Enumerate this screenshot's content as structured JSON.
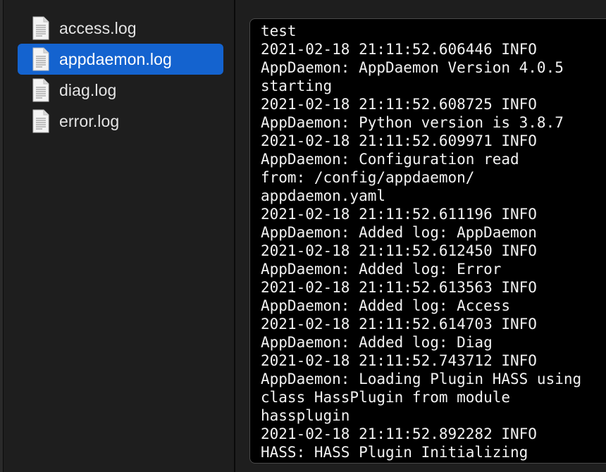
{
  "sidebar": {
    "files": [
      {
        "name": "access.log",
        "icon": "document-icon",
        "selected": false
      },
      {
        "name": "appdaemon.log",
        "icon": "document-icon",
        "selected": true
      },
      {
        "name": "diag.log",
        "icon": "document-icon",
        "selected": false
      },
      {
        "name": "error.log",
        "icon": "document-icon",
        "selected": false
      }
    ]
  },
  "preview": {
    "lines": [
      "test",
      "2021-02-18 21:11:52.606446 INFO",
      "AppDaemon: AppDaemon Version 4.0.5",
      "starting",
      "2021-02-18 21:11:52.608725 INFO",
      "AppDaemon: Python version is 3.8.7",
      "2021-02-18 21:11:52.609971 INFO",
      "AppDaemon: Configuration read",
      "from: /config/appdaemon/",
      "appdaemon.yaml",
      "2021-02-18 21:11:52.611196 INFO",
      "AppDaemon: Added log: AppDaemon",
      "2021-02-18 21:11:52.612450 INFO",
      "AppDaemon: Added log: Error",
      "2021-02-18 21:11:52.613563 INFO",
      "AppDaemon: Added log: Access",
      "2021-02-18 21:11:52.614703 INFO",
      "AppDaemon: Added log: Diag",
      "2021-02-18 21:11:52.743712 INFO",
      "AppDaemon: Loading Plugin HASS using",
      "class HassPlugin from module",
      "hassplugin",
      "2021-02-18 21:11:52.892282 INFO",
      "HASS: HASS Plugin Initializing"
    ]
  },
  "colors": {
    "selection": "#1463cf",
    "background": "#1e1e1e",
    "preview_background": "#000000"
  }
}
